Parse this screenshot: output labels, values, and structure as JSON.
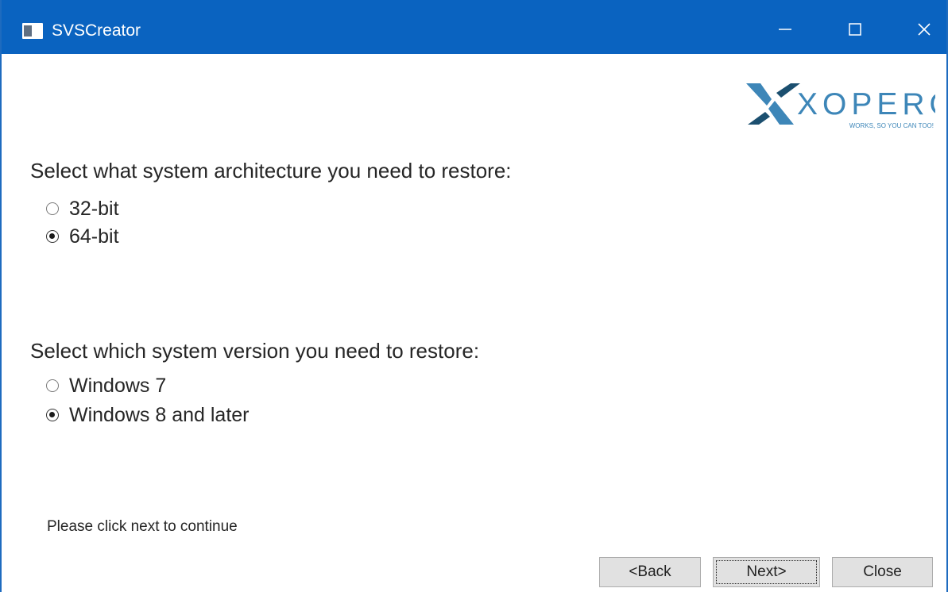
{
  "window": {
    "title": "SVSCreator",
    "controls": {
      "minimize": "minimize-icon",
      "maximize": "maximize-icon",
      "close": "close-icon"
    },
    "colors": {
      "titlebar": "#0a63c0",
      "logo_blue": "#3d86b8",
      "logo_teal": "#1b4f6f"
    }
  },
  "logo": {
    "text": "XOPERO",
    "tagline": "WORKS, SO YOU CAN TOO!"
  },
  "architecture": {
    "prompt": "Select what system architecture you need to restore:",
    "options": [
      {
        "label": "32-bit",
        "checked": false
      },
      {
        "label": "64-bit",
        "checked": true
      }
    ]
  },
  "version": {
    "prompt": "Select which system version you need to restore:",
    "options": [
      {
        "label": "Windows 7",
        "checked": false
      },
      {
        "label": "Windows 8 and later",
        "checked": true
      }
    ]
  },
  "status_text": "Please click next to continue",
  "buttons": {
    "back": "<Back",
    "next": "Next>",
    "close": "Close"
  }
}
